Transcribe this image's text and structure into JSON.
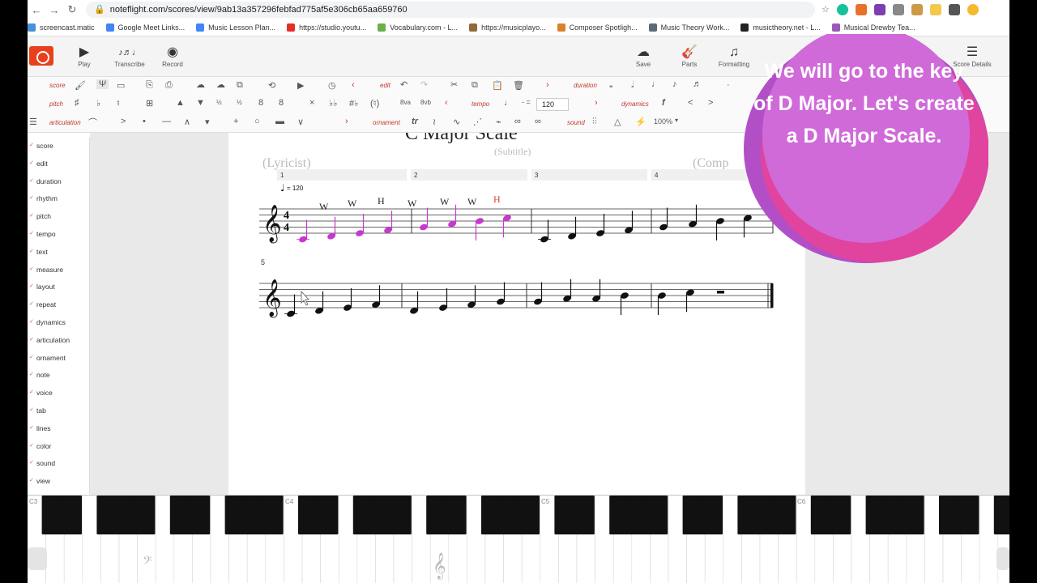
{
  "browser": {
    "url": "noteflight.com/scores/view/9ab13a357296febfad775af5e306cb65aa659760"
  },
  "bookmarks": [
    {
      "label": "screencast.matic",
      "color": "#4a90d9"
    },
    {
      "label": "Google Meet Links...",
      "color": "#4285f4"
    },
    {
      "label": "Music Lesson Plan...",
      "color": "#4285f4"
    },
    {
      "label": "https://studio.youtu...",
      "color": "#e52d27"
    },
    {
      "label": "Vocabulary.com - L...",
      "color": "#6ab04c"
    },
    {
      "label": "https://musicplayo...",
      "color": "#8e6c3a"
    },
    {
      "label": "Composer Spotligh...",
      "color": "#d9822b"
    },
    {
      "label": "Music Theory Work...",
      "color": "#5b6b7a"
    },
    {
      "label": "musictheory.net - L...",
      "color": "#222222"
    },
    {
      "label": "Musical Drewby Tea...",
      "color": "#9b59b6"
    }
  ],
  "app": {
    "buttons": [
      {
        "label": "Play",
        "icon": "play-icon"
      },
      {
        "label": "Transcribe",
        "icon": "transcribe-icon"
      },
      {
        "label": "Record",
        "icon": "record-icon"
      }
    ],
    "right_buttons": [
      {
        "label": "Save",
        "icon": "cloud-save-icon"
      },
      {
        "label": "Parts",
        "icon": "guitar-icon"
      },
      {
        "label": "Formatting",
        "icon": "formatting-icon"
      },
      {
        "label": "Score Details",
        "icon": "score-details-icon"
      }
    ],
    "toolbar": {
      "row1": {
        "score": "score",
        "edit": "edit",
        "duration": "duration"
      },
      "row2": {
        "pitch": "pitch",
        "tempo": "tempo",
        "tempo_value": "120",
        "dynamics": "dynamics"
      },
      "row3": {
        "articulation": "articulation",
        "ornament": "ornament",
        "sound": "sound",
        "zoom": "100%"
      }
    },
    "sidebar": [
      "score",
      "edit",
      "duration",
      "rhythm",
      "pitch",
      "tempo",
      "text",
      "measure",
      "layout",
      "repeat",
      "dynamics",
      "articulation",
      "ornament",
      "note",
      "voice",
      "tab",
      "lines",
      "color",
      "sound",
      "view"
    ]
  },
  "score": {
    "title": "C Major Scale",
    "subtitle": "(Subtitle)",
    "lyricist": "(Lyricist)",
    "composer": "(Comp",
    "tempo_mark": "= 120",
    "measure_numbers": [
      "1",
      "2",
      "3",
      "4"
    ],
    "system2_number": "5",
    "step_labels": [
      "W",
      "W",
      "H",
      "W",
      "W",
      "W",
      "H"
    ],
    "accent_color": "#c837d0",
    "label_red": "#e0452b"
  },
  "piano": {
    "labels": [
      "C3",
      "C4",
      "C5",
      "C6"
    ]
  },
  "overlay": {
    "text": "We will go to the key of D Major. Let's create a D Major Scale."
  }
}
